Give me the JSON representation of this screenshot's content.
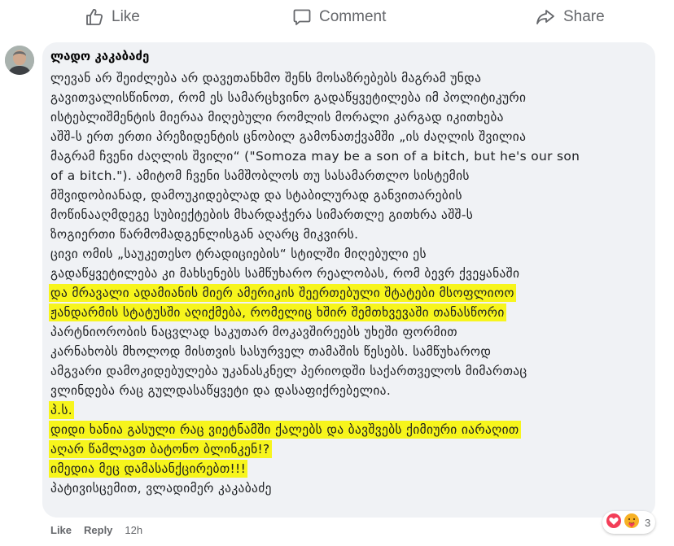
{
  "actions": {
    "like": "Like",
    "comment": "Comment",
    "share": "Share"
  },
  "comment": {
    "author": "ლადო კაკაბაძე",
    "lines": [
      "ლევან არ შეიძლება არ დავეთანხმო შენს მოსაზრებებს მაგრამ უნდა",
      "გავითვალისწინოთ, რომ ეს სამარცხვინო გადაწყვეტილება იმ პოლიტიკური",
      "ისტებლიშმენტის მიერაა მიღებული რომლის მორალი კარგად იკითხება",
      "აშშ-ს ერთ ერთი პრეზიდენტის ცნობილ გამონათქვამში „ის ძაღლის შვილია",
      "მაგრამ ჩვენი ძაღლის შვილი“ (\"Somoza may be a son of a bitch, but he's our son",
      "of a bitch.\"). ამიტომ ჩვენი სამშობლოს თუ სასამართლო სისტემის",
      "მშვიდობიანად, დამოუკიდებლად და სტაბილურად განვითარების",
      "მოწინააღმდეგე სუბიექტების მხარდაჭერა სიმართლე გითხრა აშშ-ს",
      "ზოგიერთი წარმომადგენლისგან აღარც მიკვირს.",
      "ცივი ომის „საუკეთესო ტრადიციების“ სტილში მიღებული ეს",
      "გადაწყვეტილება კი მახსენებს სამწუხარო რეალობას, რომ ბევრ ქვეყანაში",
      "და მრავალი ადამიანის მიერ ამერიკის შეერთებული შტატები მსოფლიოო",
      "ჟანდარმის სტატუსში აღიქმება, რომელიც ხშირ შემთხვევაში თანასწორი",
      "პარტნიორობის ნაცვლად საკუთარ მოკავშირეებს უხეში ფორმით",
      "კარნახობს მხოლოდ მისთვის სასურველ თამაშის წესებს. სამწუხაროდ",
      "ამგვარი დამოკიდებულება უკანასკნელ პერიოდში საქართველოს მიმართაც",
      "ვლინდება რაც გულდასაწყვეტი და დასაფიქრებელია.",
      "პ.ს.",
      "დიდი ხანია გასული რაც ვიეტნამში ქალებს და ბავშვებს ქიმიური იარაღით",
      "აღარ წამლავთ ბატონო ბლინკენ!?",
      "იმედია მეც დამასანქცირებთ!!!",
      "პატივისცემით, ვლადიმერ კაკაბაძე"
    ]
  },
  "footer": {
    "like": "Like",
    "reply": "Reply",
    "time": "12h"
  },
  "reactions": {
    "icons": [
      "love-reaction-icon",
      "care-reaction-icon"
    ],
    "count": "3"
  },
  "colors": {
    "highlight": "#f7f51c",
    "bubble": "#f0f2f5",
    "muted": "#65676b",
    "love": "#f33e58",
    "care": "#f7b125"
  }
}
